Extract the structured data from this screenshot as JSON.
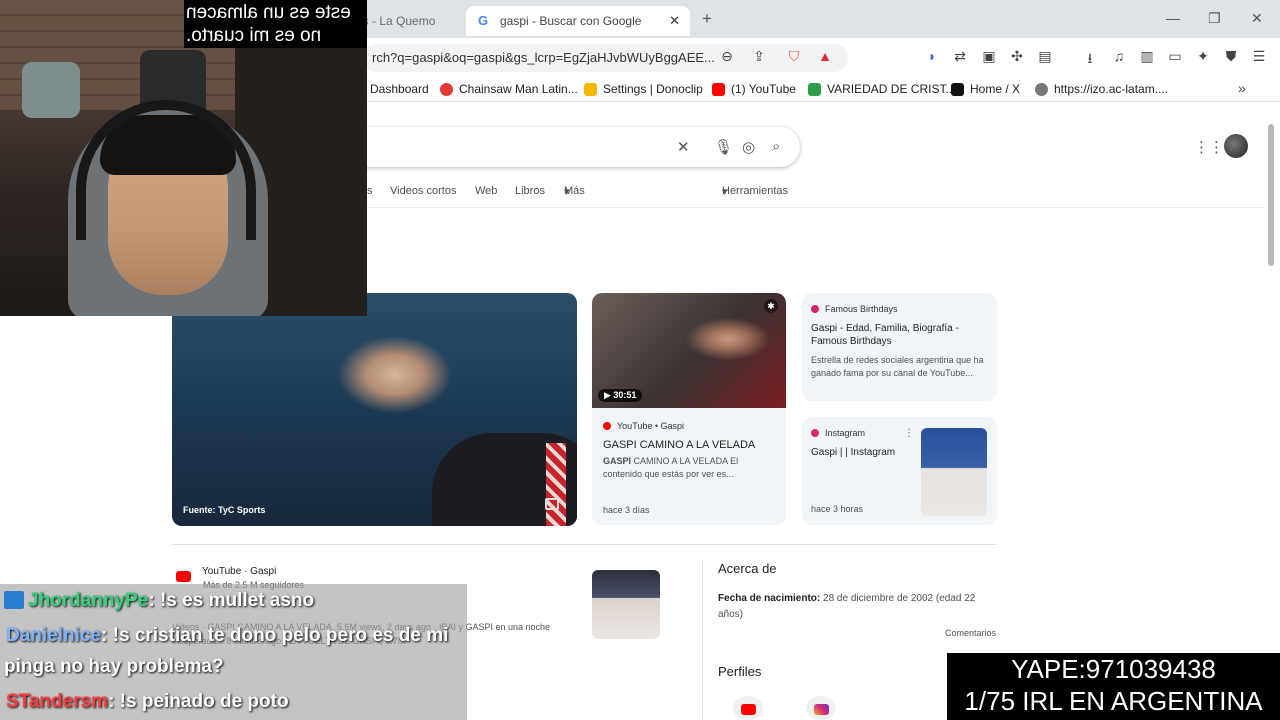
{
  "browser": {
    "tabs": [
      {
        "label": "oys - La Quemo"
      },
      {
        "label": "gaspi - Buscar con Google"
      }
    ],
    "url": "rch?q=gaspi&oq=gaspi&gs_lcrp=EgZjaHJvbWUyBggAEE...",
    "bookmarks": [
      {
        "label": "Dashboard",
        "color": "#3b6fd6"
      },
      {
        "label": "Chainsaw Man Latin...",
        "color": "#e53935"
      },
      {
        "label": "Settings | Donoclip",
        "color": "#f2b705"
      },
      {
        "label": "(1) YouTube",
        "color": "#ff0000"
      },
      {
        "label": "VARIEDAD DE CRIST...",
        "color": "#2e9e4a"
      },
      {
        "label": "Home / X",
        "color": "#111111"
      },
      {
        "label": "https://izo.ac-latam....",
        "color": "#777777"
      }
    ]
  },
  "search": {
    "filters": [
      "s",
      "Videos cortos",
      "Web",
      "Libros",
      "Más",
      "Herramientas"
    ]
  },
  "hero": {
    "source": "Fuente: TyC Sports"
  },
  "video_card": {
    "duration": "30:51",
    "source": "YouTube • Gaspi",
    "title": "GASPI CAMINO A LA VELADA",
    "snippet_bold": "GASPI",
    "snippet": "CAMINO A LA VELADA El contenido que estás por ver es...",
    "date": "hace 3 días"
  },
  "bio_card": {
    "source": "Famous Birthdays",
    "title": "Gaspi - Edad, Familia, Biografía - Famous Birthdays",
    "snippet": "Estrella de redes sociales argentina que ha ganado fama por su canal de YouTube..."
  },
  "insta_card": {
    "source": "Instagram",
    "title": "Gaspi | | Instagram",
    "date": "hace 3 horas"
  },
  "youtube_result": {
    "channel": "YouTube · Gaspi",
    "subs": "Más de 2.5 M seguidores",
    "snippet": "Videos · GASPI CAMINO A LA VELADA, 5.6M views, 2 days ago · IBAI y GASPI en una noche inesperada... 8 months ago · LA VUELTA DE GASPI, 6.7M"
  },
  "about": {
    "heading": "Acerca de",
    "birth_label": "Fecha de nacimiento:",
    "birth_value": "28 de diciembre de 2002 (edad 22 años)",
    "comments": "Comentarios",
    "profiles": "Perfiles"
  },
  "overlay": {
    "caption_line1": "este es un almacen",
    "caption_line2": "no es mi cuarto.",
    "chat": [
      {
        "user": "JhordannyPe",
        "color": "#33d17a",
        "message": ": !s es mullet asno"
      },
      {
        "user": "Danielnice",
        "color": "#7fb2ff",
        "message": ": !s cristian te dono pelo pero es de mi"
      },
      {
        "user": "",
        "color": "#ffffff",
        "message": "pinga no hay problema?"
      },
      {
        "user": "STandersm",
        "color": "#ff3b3b",
        "message": ": !s peinado de poto"
      }
    ],
    "yape": "YAPE:971039438",
    "irl": "1/75 IRL EN ARGENTINA"
  }
}
